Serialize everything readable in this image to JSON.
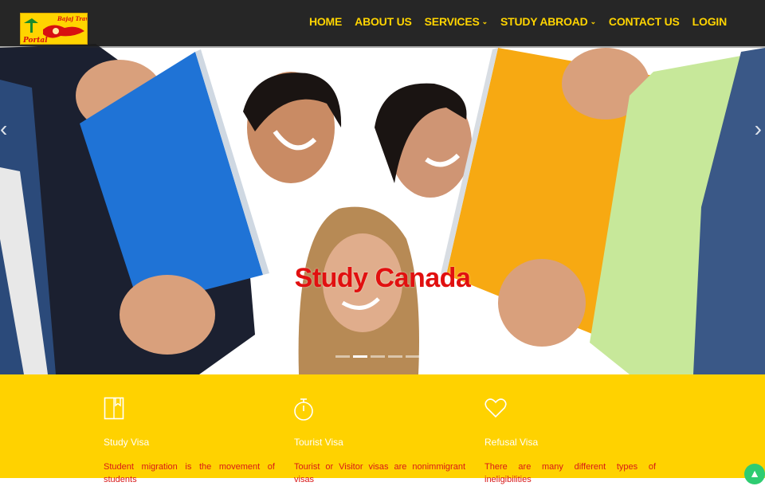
{
  "brand": {
    "logo_text_top": "Bajaj Travel",
    "logo_text_bottom": "Portal"
  },
  "nav": {
    "items": [
      {
        "label": "HOME",
        "caret": false
      },
      {
        "label": "ABOUT US",
        "caret": false
      },
      {
        "label": "SERVICES",
        "caret": true
      },
      {
        "label": "STUDY ABROAD",
        "caret": true
      },
      {
        "label": "CONTACT US",
        "caret": false
      },
      {
        "label": "LOGIN",
        "caret": false
      }
    ]
  },
  "hero": {
    "caption": "Study Canada",
    "prev_icon": "chevron-left-icon",
    "next_icon": "chevron-right-icon",
    "slide_count": 5,
    "active_slide": 2
  },
  "features": [
    {
      "icon": "book-icon",
      "title": "Study Visa",
      "text": "Student migration is the movement of students"
    },
    {
      "icon": "stopwatch-icon",
      "title": "Tourist Visa",
      "text": "Tourist or Visitor visas are nonimmigrant visas"
    },
    {
      "icon": "heart-icon",
      "title": "Refusal Visa",
      "text": "There are many different types of ineligibilities"
    }
  ],
  "colors": {
    "accent_yellow": "#ffd200",
    "caption_red": "#e11010",
    "nav_bg": "#1c1c1c",
    "back_to_top": "#2ecc71"
  }
}
